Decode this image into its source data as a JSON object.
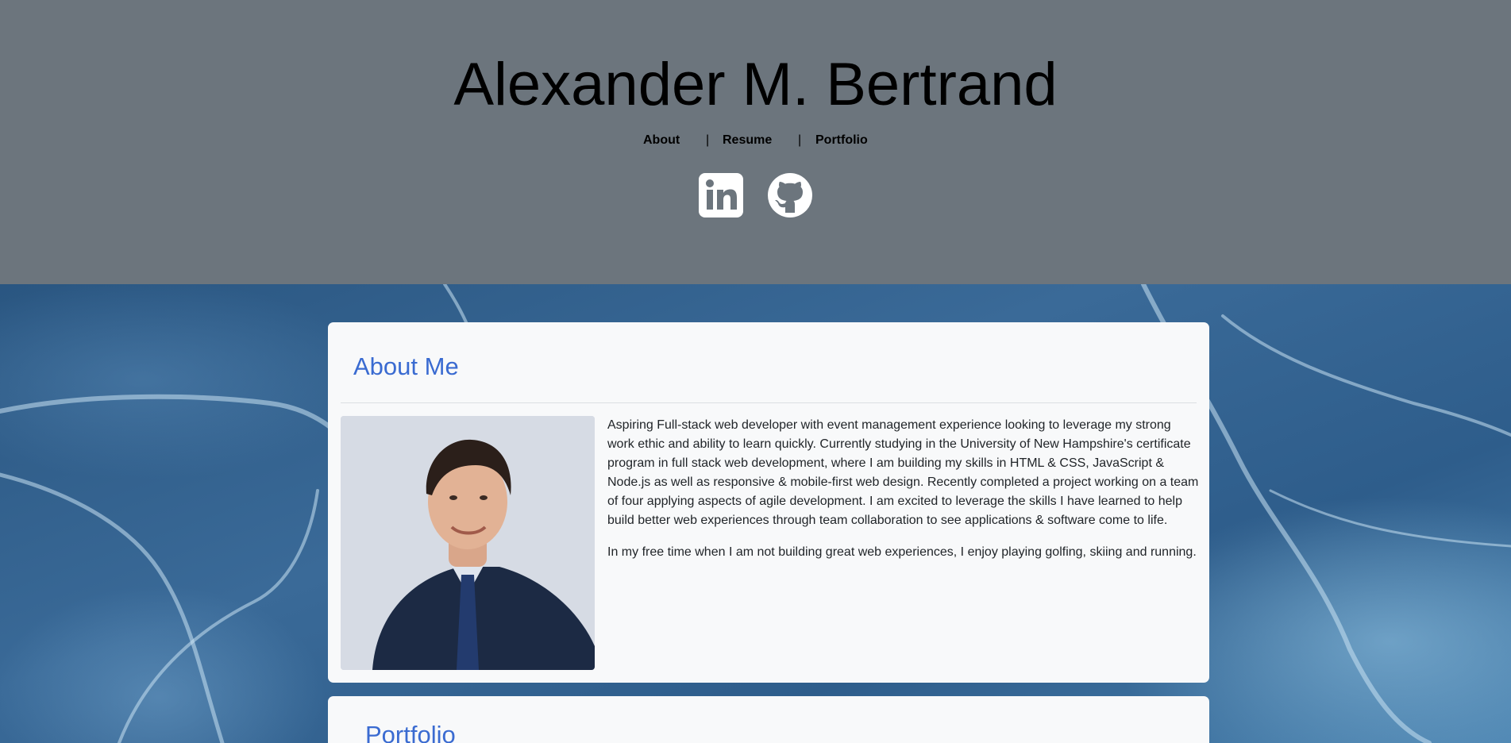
{
  "header": {
    "title": "Alexander M. Bertrand",
    "nav": {
      "about": "About",
      "resume": "Resume",
      "portfolio": "Portfolio",
      "separator": "|"
    },
    "social": [
      "linkedin-icon",
      "github-icon"
    ]
  },
  "about": {
    "heading": "About Me",
    "paragraphs": [
      "Aspiring Full-stack web developer with event management experience looking to leverage my strong work ethic and ability to learn quickly. Currently studying in the University of New Hampshire's certificate program in full stack web development, where I am building my skills in HTML & CSS, JavaScript & Node.js as well as responsive & mobile-first web design. Recently completed a project working on a team of four applying aspects of agile development. I am excited to leverage the skills I have learned to help build better web experiences through team collaboration to see applications & software come to life.",
      "In my free time when I am not building great web experiences, I enjoy playing golfing, skiing and running."
    ]
  },
  "portfolio": {
    "heading": "Portfolio"
  },
  "colors": {
    "header_bg": "#6c757d",
    "card_bg": "#f8f9fa",
    "heading_blue": "#3a6bd1"
  }
}
